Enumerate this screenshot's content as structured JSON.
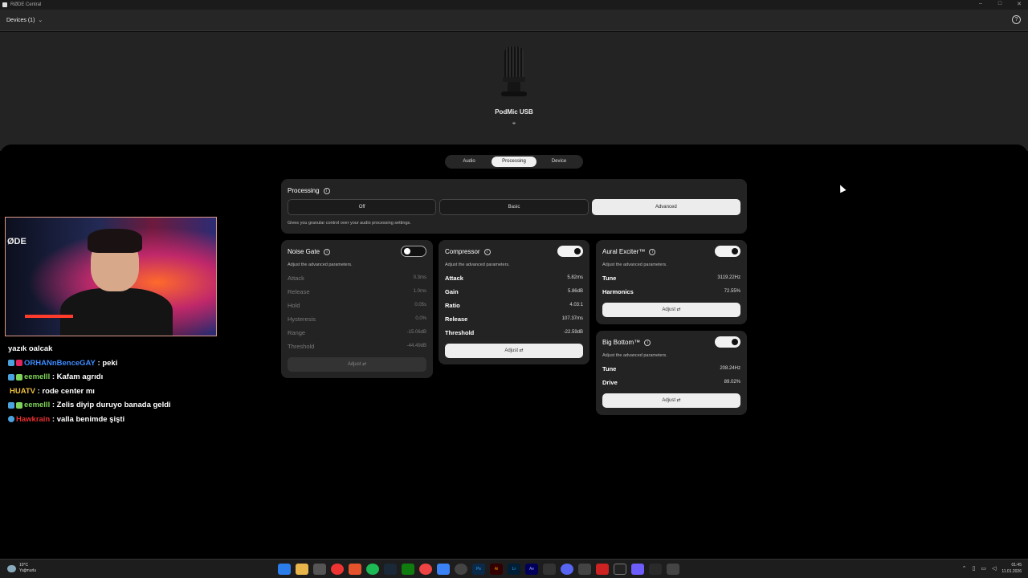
{
  "window": {
    "title": "RØDE Central",
    "controls": [
      "–",
      "□",
      "✕"
    ]
  },
  "toolbar": {
    "devices_label": "Devices (1)",
    "help": "?"
  },
  "device": {
    "name": "PodMic USB",
    "locate_icon": "⌖"
  },
  "tabs": [
    {
      "label": "Audio",
      "active": false
    },
    {
      "label": "Processing",
      "active": true
    },
    {
      "label": "Device",
      "active": false
    }
  ],
  "processing": {
    "title": "Processing",
    "modes": [
      {
        "label": "Off"
      },
      {
        "label": "Basic"
      },
      {
        "label": "Advanced",
        "active": true
      }
    ],
    "description": "Gives you granular control over your audio processing settings."
  },
  "noise_gate": {
    "title": "Noise Gate",
    "enabled": false,
    "description": "Adjust the advanced parameters.",
    "params": [
      {
        "label": "Attack",
        "value": "0.3ms"
      },
      {
        "label": "Release",
        "value": "1.0ms"
      },
      {
        "label": "Hold",
        "value": "0.05s"
      },
      {
        "label": "Hysteresis",
        "value": "0.0%"
      },
      {
        "label": "Range",
        "value": "-15.06dB"
      },
      {
        "label": "Threshold",
        "value": "-44.49dB"
      }
    ],
    "adjust_label": "Adjust ⇄"
  },
  "compressor": {
    "title": "Compressor",
    "enabled": true,
    "description": "Adjust the advanced parameters.",
    "params": [
      {
        "label": "Attack",
        "value": "5.82ms"
      },
      {
        "label": "Gain",
        "value": "5.86dB"
      },
      {
        "label": "Ratio",
        "value": "4.03:1"
      },
      {
        "label": "Release",
        "value": "107.37ms"
      },
      {
        "label": "Threshold",
        "value": "-22.59dB"
      }
    ],
    "adjust_label": "Adjust ⇄"
  },
  "aural_exciter": {
    "title": "Aural Exciter™",
    "enabled": true,
    "description": "Adjust the advanced parameters.",
    "params": [
      {
        "label": "Tune",
        "value": "3119.22Hz"
      },
      {
        "label": "Harmonics",
        "value": "72.55%"
      }
    ],
    "adjust_label": "Adjust ⇄"
  },
  "big_bottom": {
    "title": "Big Bottom™",
    "enabled": true,
    "description": "Adjust the advanced parameters.",
    "params": [
      {
        "label": "Tune",
        "value": "208.24Hz"
      },
      {
        "label": "Drive",
        "value": "89.02%"
      }
    ],
    "adjust_label": "Adjust ⇄"
  },
  "webcam": {
    "logo_text": "ØDE"
  },
  "chat": [
    {
      "user": "",
      "sep": "",
      "text": "yazık oalcak",
      "color": "#ffffff"
    },
    {
      "user": "ORHANnBenceGAY",
      "sep": " : ",
      "text": "peki",
      "color": "#3d8bff"
    },
    {
      "user": "eemelll",
      "sep": " : ",
      "text": "Kafam agrıdı",
      "color": "#7fd45a"
    },
    {
      "user": "HUATV",
      "sep": " : ",
      "text": "rode center mı",
      "color": "#f0c23c"
    },
    {
      "user": "eemelll",
      "sep": " : ",
      "text": "Zelis diyip duruyo banada geldi",
      "color": "#7fd45a"
    },
    {
      "user": "Hawkrain",
      "sep": " : ",
      "text": "valla benimde şişti",
      "color": "#e53030"
    }
  ],
  "taskbar": {
    "weather_temp": "10°C",
    "weather_desc": "Yağmurlu",
    "time": "01:45",
    "date": "11.01.2026",
    "app_labels": [
      "Ps",
      "Ai",
      "Lr",
      "Ae"
    ]
  }
}
